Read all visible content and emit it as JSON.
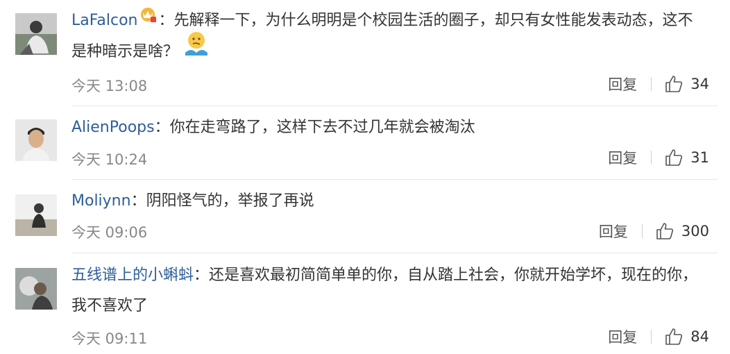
{
  "comments": [
    {
      "username": "LaFalcon",
      "badge_icon": "crown-vip-badge-icon",
      "text": "：先解释一下，为什么明明是个校园生活的圈子，却只有女性能发表动态，这不是种暗示是啥？",
      "emoji_icon": "thinking-shrug-emoji-icon",
      "time": "今天 13:08",
      "reply_label": "回复",
      "likes": "34"
    },
    {
      "username": "AlienPoops",
      "text": "：你在走弯路了，这样下去不过几年就会被淘汰",
      "time": "今天 10:24",
      "reply_label": "回复",
      "likes": "31"
    },
    {
      "username": "Moliynn",
      "text": "：阴阳怪气的，举报了再说",
      "time": "今天 09:06",
      "reply_label": "回复",
      "likes": "300"
    },
    {
      "username": "五线谱上的小蝌蚪",
      "text": "：还是喜欢最初简简单单的你，自从踏上社会，你就开始学坏，现在的你，我不喜欢了",
      "time": "今天 09:11",
      "reply_label": "回复",
      "likes": "84"
    }
  ],
  "colors": {
    "username": "#2e5d9a",
    "meta": "#888888",
    "divider": "#e6e6e6"
  },
  "icons": {
    "like": "thumbs-up-outline-icon",
    "avatar": "user-avatar"
  }
}
